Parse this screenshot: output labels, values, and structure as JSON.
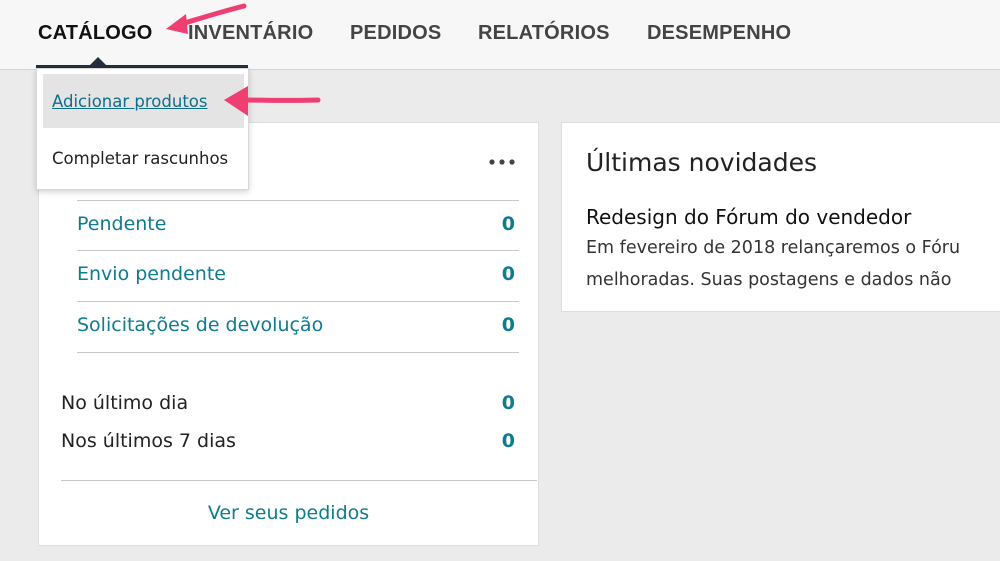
{
  "nav": {
    "tabs": [
      {
        "label": "CATÁLOGO",
        "active": true
      },
      {
        "label": "INVENTÁRIO",
        "active": false
      },
      {
        "label": "PEDIDOS",
        "active": false
      },
      {
        "label": "RELATÓRIOS",
        "active": false
      },
      {
        "label": "DESEMPENHO",
        "active": false
      }
    ]
  },
  "dropdown": {
    "items": [
      {
        "label": "Adicionar produtos",
        "hovered": true
      },
      {
        "label": "Completar rascunhos",
        "hovered": false
      }
    ]
  },
  "orders_card": {
    "more_icon": "more-horizontal-icon",
    "rows": [
      {
        "label": "Pendente",
        "count": "0"
      },
      {
        "label": "Envio pendente",
        "count": "0"
      },
      {
        "label": "Solicitações de devolução",
        "count": "0"
      }
    ],
    "periods": [
      {
        "label": "No último dia",
        "count": "0"
      },
      {
        "label": "Nos últimos 7 dias",
        "count": "0"
      }
    ],
    "footer_link": "Ver seus pedidos"
  },
  "news_card": {
    "title": "Últimas novidades",
    "headline": "Redesign do Fórum do vendedor",
    "text_line1": "Em fevereiro de 2018 relançaremos o Fóru",
    "text_line2": "melhoradas. Suas postagens e dados não"
  },
  "annotations": {
    "arrow_color": "#ef3f72"
  },
  "colors": {
    "link": "#0f7b8f",
    "nav_active_bar": "#232f3e",
    "page_bg": "#ebebeb"
  }
}
